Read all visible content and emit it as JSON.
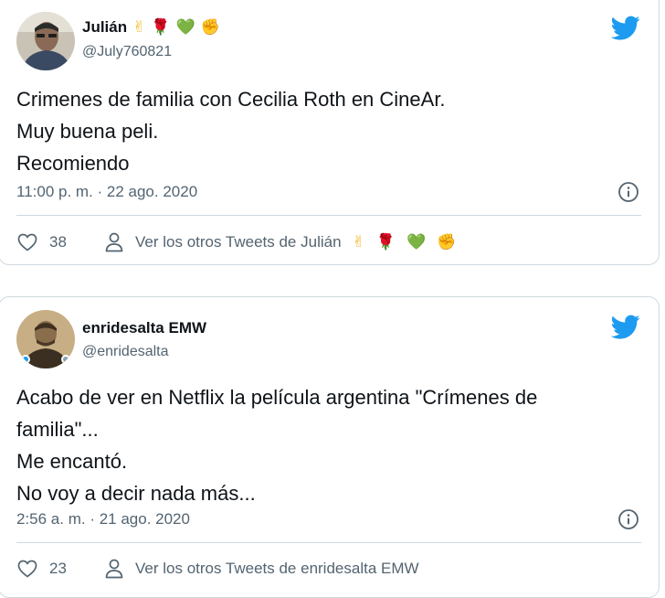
{
  "tweets": [
    {
      "display_name": "Julián",
      "handle": "@July760821",
      "lines": [
        "Crimenes de familia con Cecilia Roth en CineAr.",
        "Muy buena peli.",
        "Recomiendo"
      ],
      "timestamp": "11:00 p. m. · 22 ago. 2020",
      "like_count": "38",
      "author_link_label": "Ver los otros Tweets de Julián",
      "name_emojis": [
        {
          "glyph": "✌",
          "icon": "victory-hand-emoji",
          "color": "#f3b824"
        },
        {
          "glyph": "🌹",
          "icon": "rose-emoji",
          "color": "#c8161e"
        },
        {
          "glyph": "💚",
          "icon": "green-heart-emoji",
          "color": "#77b255"
        },
        {
          "glyph": "✊",
          "icon": "raised-fist-emoji",
          "color": "#f3b824"
        }
      ]
    },
    {
      "display_name": "enridesalta EMW",
      "handle": "@enridesalta",
      "lines": [
        "Acabo de ver en Netflix la película argentina \"Crímenes de",
        "familia\"...",
        "Me encantó.",
        "No voy a decir nada más..."
      ],
      "timestamp": "2:56 a. m. · 21 ago. 2020",
      "like_count": "23",
      "author_link_label": "Ver los otros Tweets de enridesalta EMW",
      "name_emojis": []
    }
  ],
  "colors": {
    "twitter_blue": "#1d9bf0",
    "text_primary": "#0f1419",
    "text_secondary": "#536471",
    "border": "#cfd9de"
  },
  "icons": {
    "brand": "twitter-bird-icon",
    "info": "info-icon",
    "like": "heart-icon",
    "author": "person-icon"
  }
}
